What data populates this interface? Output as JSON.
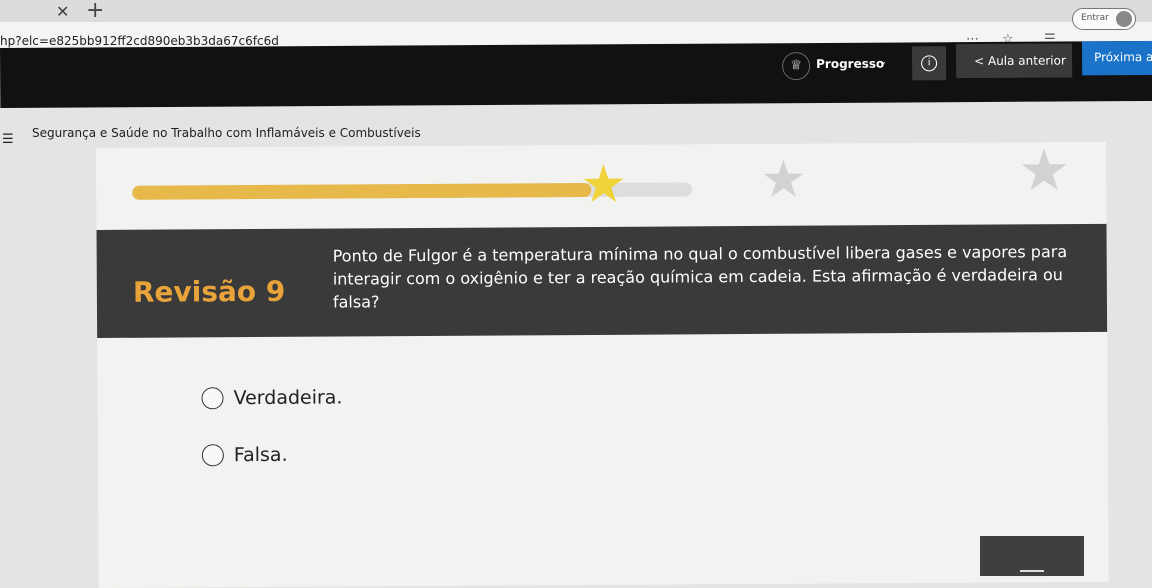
{
  "browser": {
    "url": "hp?elc=e825bb912ff2cd890eb3b3da67c6fc6d",
    "signin_label": "Entrar",
    "icons": [
      "close-icon",
      "plus-icon",
      "more-icon",
      "star-icon",
      "favorites-icon",
      "profile-icon"
    ]
  },
  "header": {
    "progress_label": "Progresso",
    "prev_label": "< Aula anterior",
    "next_label": "Próxima a",
    "icons": [
      "trophy-icon",
      "chevron-down-icon",
      "info-icon"
    ]
  },
  "course": {
    "title": "Segurança e Saúde no Trabalho com Inflamáveis e Combustíveis"
  },
  "progress": {
    "fraction": 0.82,
    "stars_total": 3,
    "stars_earned": 1
  },
  "question": {
    "title": "Revisão 9",
    "text": "Ponto de Fulgor é a temperatura mínima no qual o combustível libera gases e vapores para interagir com o oxigênio e ter a reação química em cadeia. Esta afirmação é verdadeira ou falsa?",
    "options": [
      "Verdadeira.",
      "Falsa."
    ]
  },
  "colors": {
    "header_bg": "#111111",
    "next_btn": "#1a73c8",
    "banner_bg": "#3a3a3a",
    "accent": "#e8a33a",
    "progress_fill": "#e6b94a",
    "star_gold": "#f0d23a"
  }
}
